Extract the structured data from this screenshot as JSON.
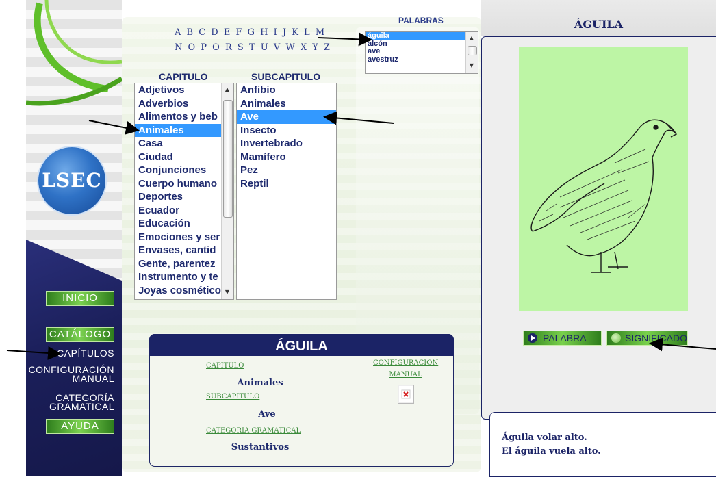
{
  "alphabet": {
    "row1": "A B C D E F G H I J K L M",
    "row2": "N O P O R S T U V W X Y Z"
  },
  "words": {
    "title": "PALABRAS",
    "items": [
      "águila",
      "alcón",
      "ave",
      "avestruz"
    ],
    "selected_index": 0
  },
  "chapters": {
    "title": "CAPITULO",
    "items": [
      "Adjetivos",
      "Adverbios",
      "Alimentos y beb",
      "Animales",
      "Casa",
      "Ciudad",
      "Conjunciones",
      "Cuerpo humano",
      "Deportes",
      "Ecuador",
      "Educación",
      "Emociones y ser",
      "Envases, cantid",
      "Gente, parentez",
      "Instrumento y te",
      "Joyas cosmético"
    ],
    "selected_index": 3
  },
  "subchapters": {
    "title": "SUBCAPITULO",
    "items": [
      "Anfibio",
      "Animales",
      "Ave",
      "Insecto",
      "Invertebrado",
      "Mamífero",
      "Pez",
      "Reptil"
    ],
    "selected_index": 2
  },
  "nav": {
    "inicio": "INICIO",
    "catalogo": "CATÁLOGO",
    "capitulos": "CAPÍTULOS",
    "configuracion_line1": "CONFIGURACIÓN",
    "configuracion_line2": "MANUAL",
    "categoria_line1": "CATEGORÍA",
    "categoria_line2": "GRAMATICAL",
    "ayuda": "AYUDA"
  },
  "logo_text": "LSEC",
  "card": {
    "title": "ÁGUILA",
    "capitulo_label": "CAPITULO",
    "capitulo_value": "Animales",
    "subcapitulo_label": "SUBCAPITULO",
    "subcapitulo_value": "Ave",
    "categoria_label": "CATEGORIA GRAMATICAL",
    "categoria_value": "Sustantivos",
    "config_label_line1": "CONFIGURACION",
    "config_label_line2": "MANUAL"
  },
  "right": {
    "title": "ÁGUILA",
    "palabra_button": "PALABRA",
    "significado_button": "SIGNIFICADO",
    "example_line1": "Águila volar alto.",
    "example_line2": "El águila vuela alto."
  },
  "colors": {
    "navy": "#1b2366",
    "selection": "#3399ff",
    "green_button": "#4fae2e",
    "image_bg": "#bdf5a5"
  }
}
